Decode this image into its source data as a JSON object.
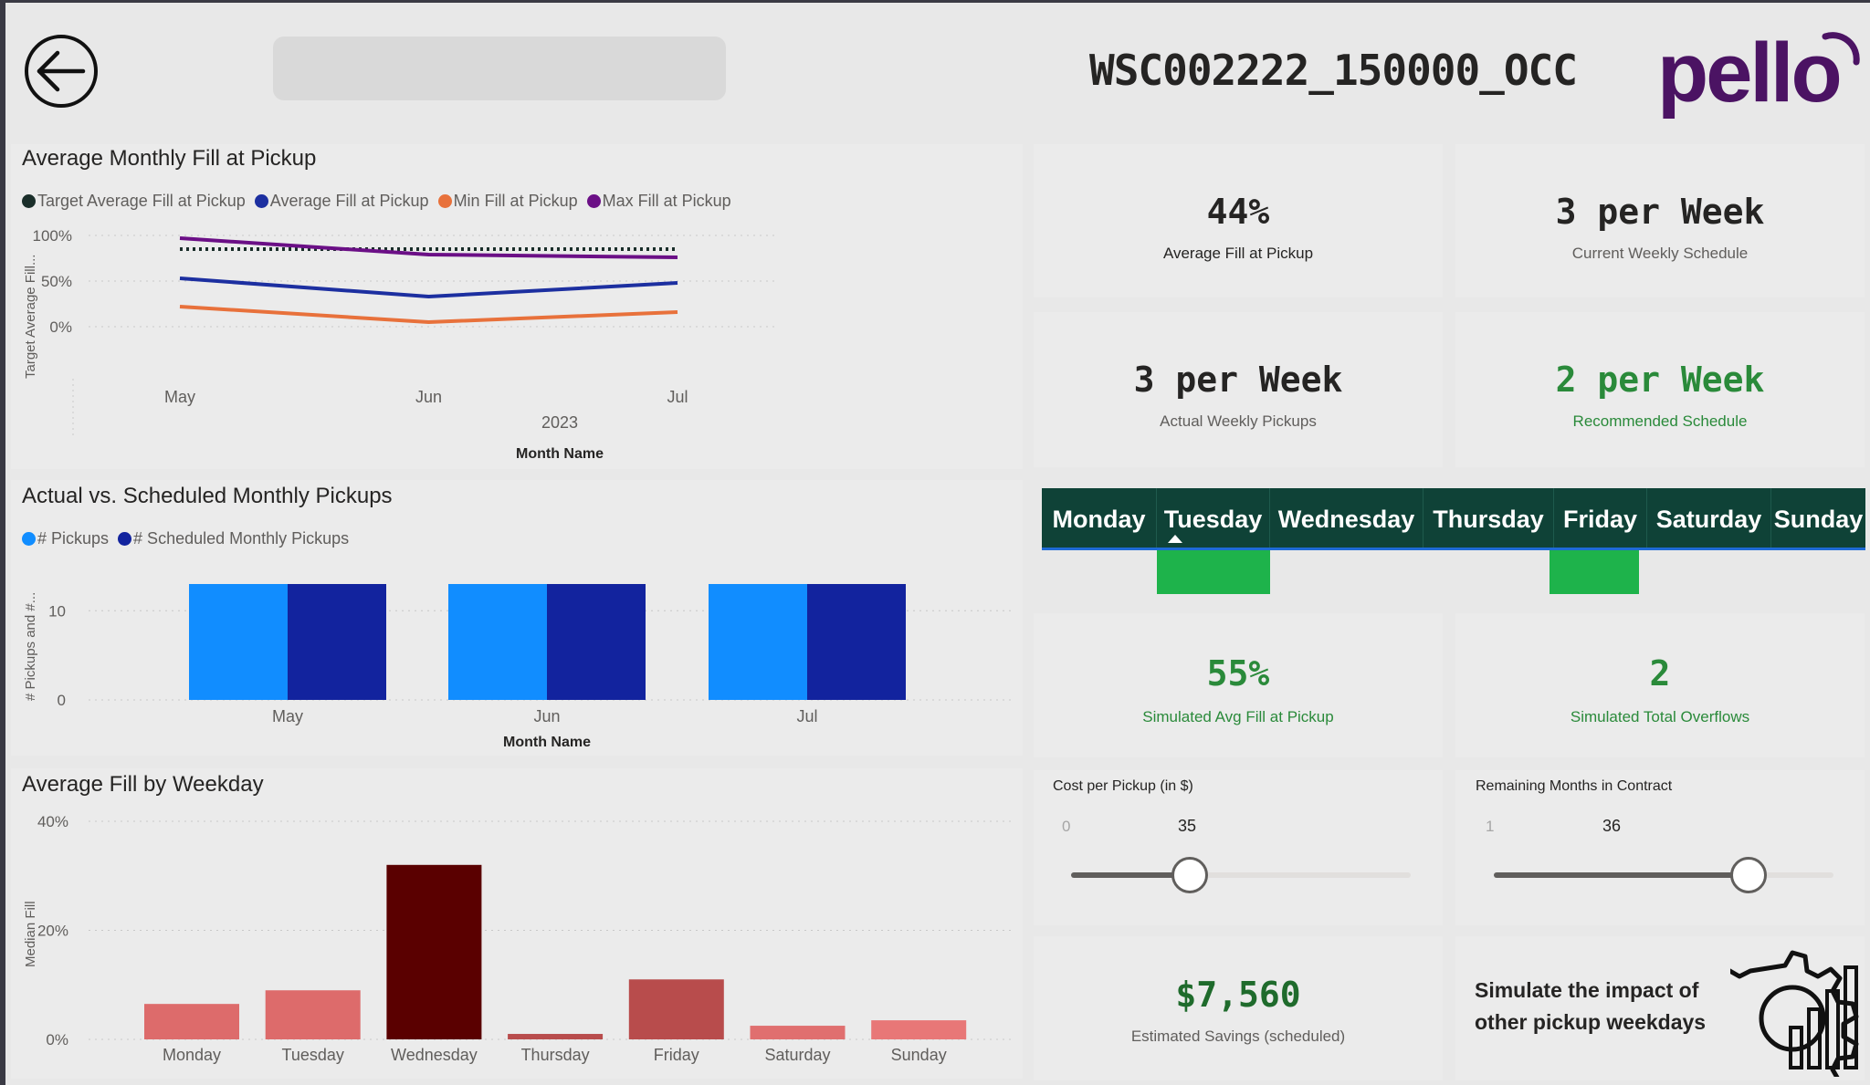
{
  "header": {
    "title": "WSC002222_150000_OCC",
    "logo_text": "pello"
  },
  "colors": {
    "target": "#1a2e2a",
    "average": "#1c2fa0",
    "min": "#e8713b",
    "max": "#6b0f86",
    "pickups": "#118dff",
    "scheduled": "#12239e",
    "weekday_selected": "#1eb34b",
    "accent_green": "#2a8a3a",
    "weekday_bar": "#0f4237"
  },
  "fill_chart": {
    "title": "Average Monthly Fill at Pickup",
    "legend": [
      "Target Average Fill at Pickup",
      "Average Fill at Pickup",
      "Min Fill at Pickup",
      "Max Fill at Pickup"
    ],
    "ylabel": "Target Average Fill...",
    "xlabel": "Month Name",
    "year_label": "2023"
  },
  "pickups_chart": {
    "title": "Actual vs. Scheduled Monthly Pickups",
    "legend": [
      "# Pickups",
      "# Scheduled Monthly Pickups"
    ],
    "ylabel": "# Pickups and #...",
    "xlabel": "Month Name"
  },
  "weekday_chart": {
    "title": "Average Fill by Weekday",
    "ylabel": "Median Fill"
  },
  "chart_data": [
    {
      "type": "line",
      "title": "Average Monthly Fill at Pickup",
      "x": [
        "May",
        "Jun",
        "Jul"
      ],
      "xlabel": "Month Name",
      "ylabel": "Target Average Fill...",
      "yticks": [
        "0%",
        "50%",
        "100%"
      ],
      "ylim": [
        0,
        100
      ],
      "series": [
        {
          "name": "Target Average Fill at Pickup",
          "values": [
            85,
            85,
            85
          ],
          "style": "dotted"
        },
        {
          "name": "Average Fill at Pickup",
          "values": [
            53,
            33,
            48
          ]
        },
        {
          "name": "Min Fill at Pickup",
          "values": [
            22,
            5,
            16
          ]
        },
        {
          "name": "Max Fill at Pickup",
          "values": [
            97,
            79,
            76
          ]
        }
      ]
    },
    {
      "type": "bar",
      "title": "Actual vs. Scheduled Monthly Pickups",
      "categories": [
        "May",
        "Jun",
        "Jul"
      ],
      "xlabel": "Month Name",
      "ylabel": "# Pickups and #...",
      "yticks": [
        "0",
        "10"
      ],
      "ylim": [
        0,
        13
      ],
      "series": [
        {
          "name": "# Pickups",
          "values": [
            13,
            13,
            13
          ]
        },
        {
          "name": "# Scheduled Monthly Pickups",
          "values": [
            13,
            13,
            13
          ]
        }
      ]
    },
    {
      "type": "bar",
      "title": "Average Fill by Weekday",
      "categories": [
        "Monday",
        "Tuesday",
        "Wednesday",
        "Thursday",
        "Friday",
        "Saturday",
        "Sunday"
      ],
      "ylabel": "Median Fill",
      "yticks": [
        "0%",
        "20%",
        "40%"
      ],
      "ylim": [
        0,
        40
      ],
      "values": [
        6.5,
        9,
        32,
        1,
        11,
        2.5,
        3.5
      ],
      "colors": [
        "#dd6b6b",
        "#dd6b6b",
        "#5a0000",
        "#b84c4c",
        "#b84c4c",
        "#e06f6f",
        "#e87777"
      ]
    }
  ],
  "kpis": {
    "avg_fill": {
      "value": "44%",
      "label": "Average Fill at Pickup"
    },
    "current_schedule": {
      "value": "3 per Week",
      "label": "Current Weekly Schedule"
    },
    "actual_pickups": {
      "value": "3 per Week",
      "label": "Actual Weekly Pickups"
    },
    "recommended": {
      "value": "2 per Week",
      "label": "Recommended Schedule"
    },
    "sim_avg_fill": {
      "value": "55%",
      "label": "Simulated Avg Fill at Pickup"
    },
    "sim_overflows": {
      "value": "2",
      "label": "Simulated Total Overflows"
    },
    "savings": {
      "value": "$7,560",
      "label": "Estimated Savings (scheduled)"
    }
  },
  "weekdays": {
    "items": [
      "Monday",
      "Tuesday",
      "Wednesday",
      "Thursday",
      "Friday",
      "Saturday",
      "Sunday"
    ],
    "selected": [
      "Tuesday",
      "Friday"
    ]
  },
  "sliders": {
    "cost": {
      "title": "Cost per Pickup (in $)",
      "min": "0",
      "value": "35",
      "level": 0.35
    },
    "months": {
      "title": "Remaining Months in Contract",
      "min": "1",
      "value": "36",
      "level": 0.75
    }
  },
  "simulate": {
    "text": "Simulate the impact of other pickup weekdays",
    "icon": "gear-chart-icon"
  }
}
